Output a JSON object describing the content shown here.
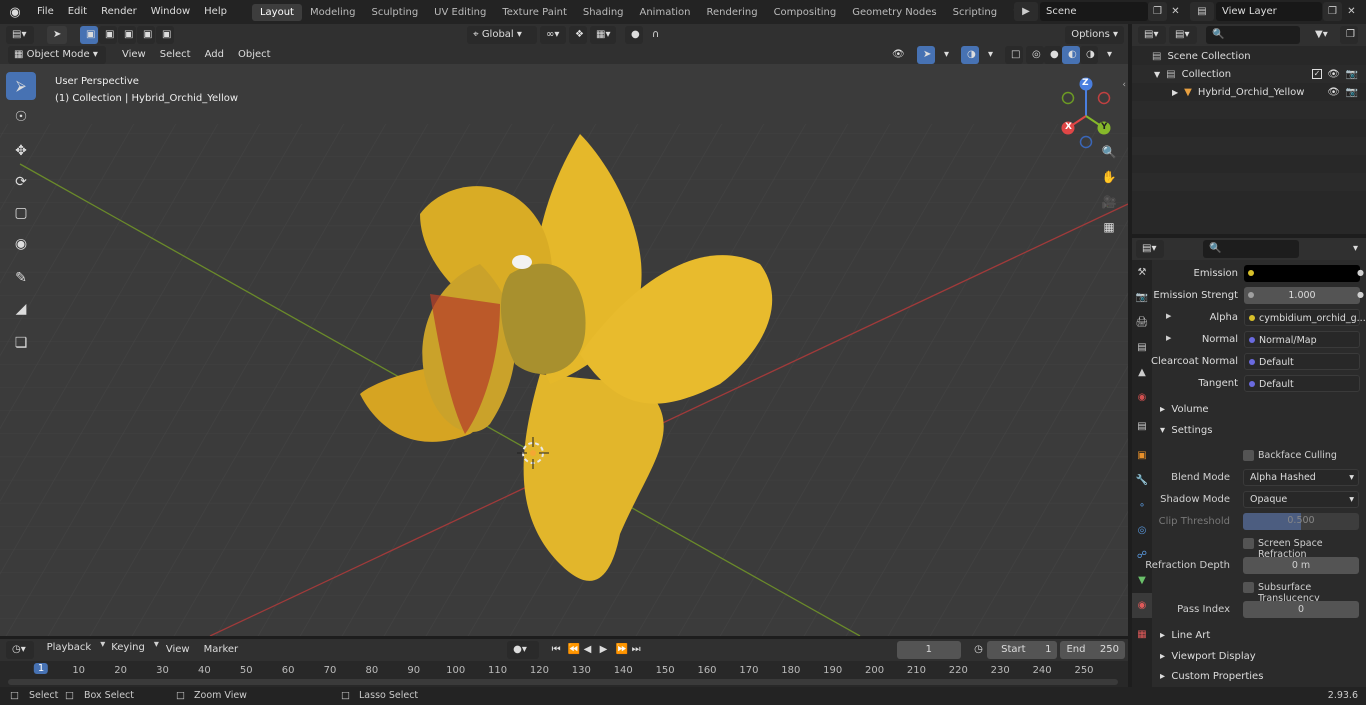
{
  "menu": [
    "File",
    "Edit",
    "Render",
    "Window",
    "Help"
  ],
  "workspaces": [
    "Layout",
    "Modeling",
    "Sculpting",
    "UV Editing",
    "Texture Paint",
    "Shading",
    "Animation",
    "Rendering",
    "Compositing",
    "Geometry Nodes",
    "Scripting"
  ],
  "scene_name": "Scene",
  "view_layer": "View Layer",
  "viewport_header": {
    "mode": "Object Mode",
    "menus": [
      "View",
      "Select",
      "Add",
      "Object"
    ],
    "transform": "Global",
    "options": "Options"
  },
  "viewport": {
    "perspective": "User Perspective",
    "collection_info": "(1) Collection | Hybrid_Orchid_Yellow",
    "gizmo": {
      "x": "X",
      "y": "Y",
      "z": "Z"
    }
  },
  "outliner": {
    "scene_collection": "Scene Collection",
    "collection": "Collection",
    "object": "Hybrid_Orchid_Yellow"
  },
  "properties": {
    "emission_label": "Emission",
    "emission_strength_label": "Emission Strengt",
    "emission_strength": "1.000",
    "alpha_label": "Alpha",
    "alpha_value": "cymbidium_orchid_g...",
    "normal_label": "Normal",
    "normal_value": "Normal/Map",
    "clearcoat_label": "Clearcoat Normal",
    "clearcoat_value": "Default",
    "tangent_label": "Tangent",
    "tangent_value": "Default",
    "volume": "Volume",
    "settings": "Settings",
    "backface": "Backface Culling",
    "blend_label": "Blend Mode",
    "blend_value": "Alpha Hashed",
    "shadow_label": "Shadow Mode",
    "shadow_value": "Opaque",
    "clip_label": "Clip Threshold",
    "clip_value": "0.500",
    "clip_fraction": 0.5,
    "ssr": "Screen Space Refraction",
    "refraction_label": "Refraction Depth",
    "refraction_value": "0 m",
    "subsurface": "Subsurface Translucency",
    "pass_label": "Pass Index",
    "pass_value": "0",
    "line_art": "Line Art",
    "viewport_display": "Viewport Display",
    "custom_props": "Custom Properties"
  },
  "timeline": {
    "menus": [
      "Playback",
      "Keying",
      "View",
      "Marker"
    ],
    "current_frame": "1",
    "start_label": "Start",
    "start": "1",
    "end_label": "End",
    "end": "250",
    "ticks": [
      "1",
      "10",
      "20",
      "30",
      "40",
      "50",
      "60",
      "70",
      "80",
      "90",
      "100",
      "110",
      "120",
      "130",
      "140",
      "150",
      "160",
      "170",
      "180",
      "190",
      "200",
      "210",
      "220",
      "230",
      "240",
      "250"
    ]
  },
  "status": {
    "select": "Select",
    "box_select": "Box Select",
    "zoom_view": "Zoom View",
    "lasso_select": "Lasso Select",
    "version": "2.93.6"
  }
}
